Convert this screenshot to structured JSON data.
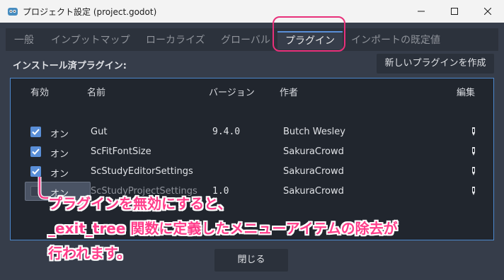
{
  "window": {
    "title": "プロジェクト設定 (project.godot)"
  },
  "tabs": [
    {
      "label": "一般"
    },
    {
      "label": "インプットマップ"
    },
    {
      "label": "ローカライズ"
    },
    {
      "label": "グローバル"
    },
    {
      "label": "プラグイン"
    },
    {
      "label": "インポートの既定値"
    }
  ],
  "active_tab": "プラグイン",
  "plugins_section": {
    "title": "インストール済プラグイン:",
    "create_button": "新しいプラグインを作成",
    "columns": [
      "有効",
      "名前",
      "バージョン",
      "作者",
      "編集"
    ],
    "rows": [
      {
        "enabled": true,
        "status": "オン",
        "name": "Gut",
        "version": "9.4.0",
        "author": "Butch Wesley"
      },
      {
        "enabled": true,
        "status": "オン",
        "name": "ScFitFontSize",
        "version": "",
        "author": "SakuraCrowd"
      },
      {
        "enabled": true,
        "status": "オン",
        "name": "ScStudyEditorSettings",
        "version": "",
        "author": "SakuraCrowd"
      },
      {
        "enabled": false,
        "status": "オン",
        "name": "ScStudyProjectSettings",
        "version": "1.0",
        "author": "SakuraCrowd"
      }
    ]
  },
  "annotation": {
    "line1": "プラグインを無効にすると、",
    "line2": "_exit_tree 関数に定義したメニューアイテムの除去が",
    "line3": "行われます。"
  },
  "footer": {
    "close_button": "閉じる"
  },
  "colors": {
    "accent": "#5a8fd8",
    "annotation": "#ff3d8a",
    "highlight_border": "#e8307a"
  }
}
